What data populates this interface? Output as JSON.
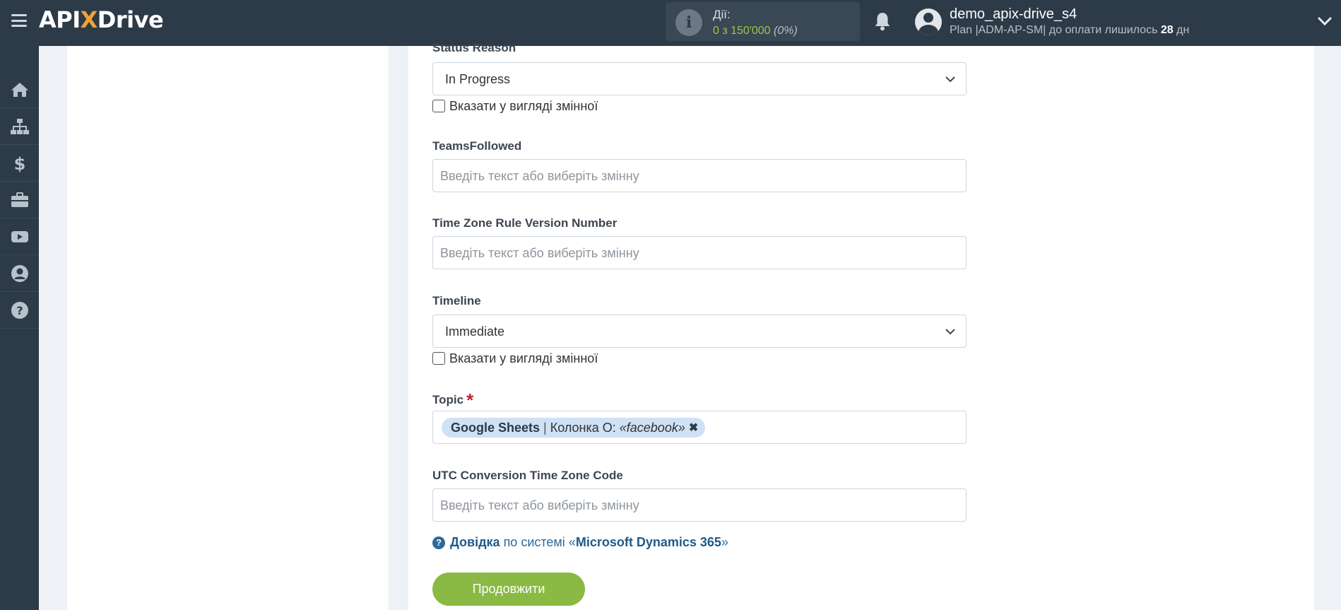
{
  "header": {
    "logo_text_1": "API",
    "logo_text_x": "X",
    "logo_text_2": "Drive",
    "actions_label": "Дії:",
    "actions_count": "0 з 150'000",
    "actions_percent": "(0%)",
    "user_name": "demo_apix-drive_s4",
    "plan_prefix": "Plan |ADM-AP-SM| до оплати лишилось",
    "plan_days": "28",
    "plan_suffix": "дн"
  },
  "sidebar": {
    "items": [
      {
        "icon": "home-icon"
      },
      {
        "icon": "sitemap-icon"
      },
      {
        "icon": "dollar-icon"
      },
      {
        "icon": "briefcase-icon"
      },
      {
        "icon": "youtube-icon"
      },
      {
        "icon": "user-circle-icon"
      },
      {
        "icon": "question-circle-icon"
      }
    ]
  },
  "form": {
    "status_reason": {
      "label": "Status Reason",
      "value": "In Progress",
      "as_variable_label": "Вказати у вигляді змінної"
    },
    "teams_followed": {
      "label": "TeamsFollowed",
      "placeholder": "Введіть текст або виберіть змінну"
    },
    "tz_rule_version": {
      "label": "Time Zone Rule Version Number",
      "placeholder": "Введіть текст або виберіть змінну"
    },
    "timeline": {
      "label": "Timeline",
      "value": "Immediate",
      "as_variable_label": "Вказати у вигляді змінної"
    },
    "topic": {
      "label": "Topic",
      "required_mark": "*",
      "tag_source": "Google Sheets",
      "tag_separator": "|",
      "tag_column": "Колонка О:",
      "tag_value": "«facebook»",
      "tag_remove": "✖"
    },
    "utc_tz_code": {
      "label": "UTC Conversion Time Zone Code",
      "placeholder": "Введіть текст або виберіть змінну"
    }
  },
  "help": {
    "link_label": "Довідка",
    "middle_text": "по системі «",
    "system_name": "Microsoft Dynamics 365",
    "end_text": "»"
  },
  "continue_button": "Продовжити",
  "colors": {
    "topbar": "#2d3a47",
    "accent_green": "#8ab944",
    "link_blue": "#2c6a9a",
    "tag_bg": "#cfe1f5",
    "required_red": "#c0262d"
  }
}
